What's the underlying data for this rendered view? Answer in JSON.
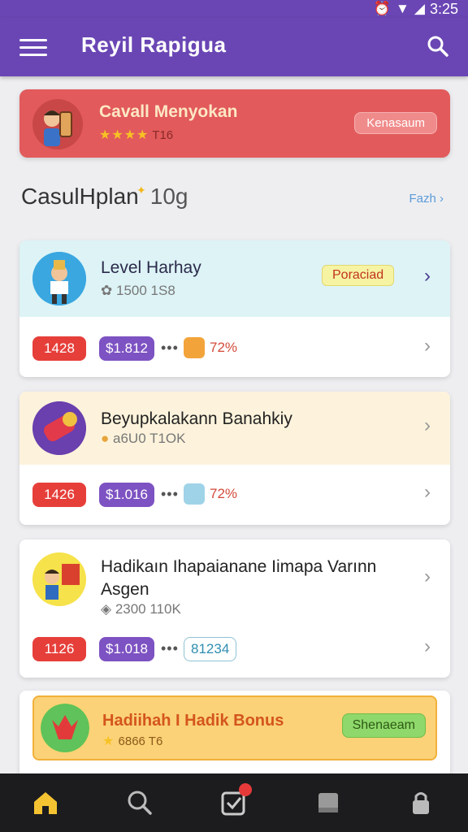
{
  "status_bar": {
    "time": "3:25"
  },
  "app_bar": {
    "title": "Reyil Rapigua"
  },
  "featured": {
    "title": "Cavall Menyokan",
    "stars": "★★★★",
    "rating_value": "T16",
    "button_label": "Kenasaum"
  },
  "section": {
    "title": "CasulHplan",
    "count": "10g",
    "see_all": "Fazh"
  },
  "cards": [
    {
      "title": "Level Harhay",
      "subtitle": "1500 1S8",
      "tag": "Poraciad",
      "stat_red": "1428",
      "stat_purple": "$1.812",
      "dots": "•••",
      "percent": "72%"
    },
    {
      "title": "Beyupkalakann Banahkiy",
      "subtitle": "a6U0 T1OK",
      "stat_red": "1426",
      "stat_purple": "$1.016",
      "dots": "•••",
      "percent": "72%"
    },
    {
      "title": "Hadikaın Ihapaianane Iimapa Varınn Asgen",
      "subtitle": "2300 110K",
      "stat_red": "1126",
      "stat_purple": "$1.018",
      "dots": "•••",
      "outline_value": "81234"
    }
  ],
  "bonus": {
    "title": "Hadiihah I Hadik Bonus",
    "stars": "★",
    "rating_value": "6866 T6",
    "button_label": "Shenaeam"
  },
  "colors": {
    "primary": "#6a46b4",
    "featured": "#e25a5b",
    "accent_red": "#e63f3a",
    "accent_purple": "#7d52c2"
  },
  "icons": [
    "menu-icon",
    "search-icon",
    "home-icon",
    "search-nav-icon",
    "tasks-icon",
    "library-icon",
    "lock-icon",
    "chevron-right-icon"
  ]
}
